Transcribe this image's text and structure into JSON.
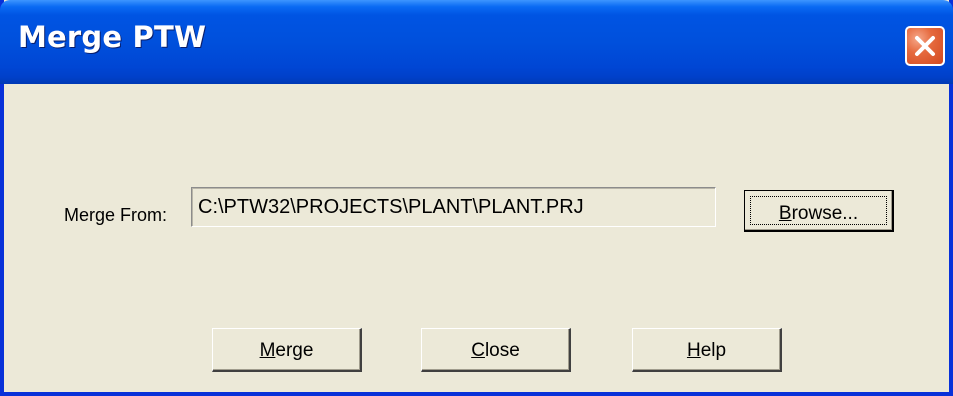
{
  "window": {
    "title": "Merge PTW",
    "close_icon": "close-x-icon"
  },
  "form": {
    "merge_from_label": "Merge From:",
    "merge_from_value": "C:\\PTW32\\PROJECTS\\PLANT\\PLANT.PRJ"
  },
  "buttons": {
    "browse": {
      "mnemonic": "B",
      "rest": "rowse..."
    },
    "merge": {
      "mnemonic": "M",
      "rest": "erge"
    },
    "close": {
      "mnemonic": "C",
      "rest": "lose"
    },
    "help": {
      "mnemonic": "H",
      "rest": "elp"
    }
  },
  "colors": {
    "titlebar": "#0054e3",
    "dialog_bg": "#ece9d8",
    "close_button": "#e66a3e"
  }
}
